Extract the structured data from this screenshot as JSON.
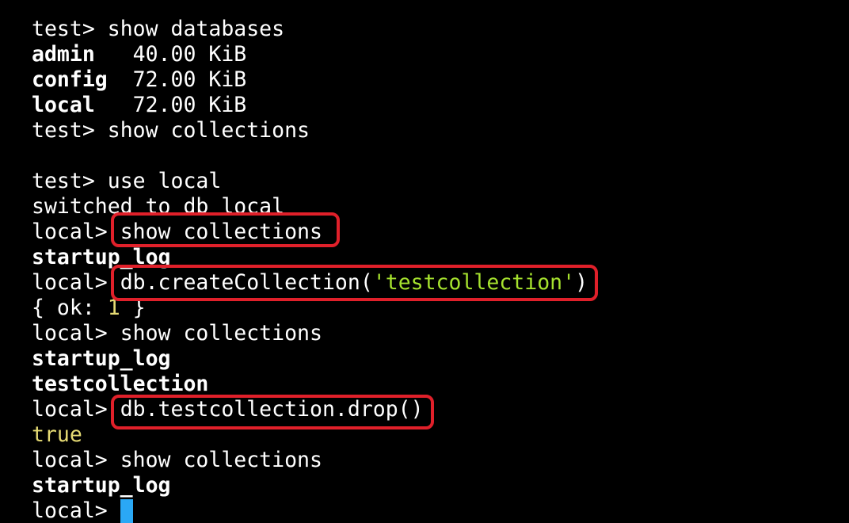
{
  "terminal": {
    "prompt_test": "test> ",
    "prompt_local": "local> ",
    "cmd_show_databases": "show databases",
    "db_list": [
      {
        "name": "admin",
        "size": "   40.00 KiB"
      },
      {
        "name": "config",
        "size": "  72.00 KiB"
      },
      {
        "name": "local",
        "size": "   72.00 KiB"
      }
    ],
    "cmd_show_collections": "show collections",
    "cmd_use_local": "use local",
    "switched_msg": "switched to db local",
    "coll_startup": "startup_log",
    "cmd_create_prefix": "db.createCollection(",
    "cmd_create_arg": "'testcollection'",
    "cmd_create_suffix": ")",
    "ok_prefix": "{ ok: ",
    "ok_value": "1",
    "ok_suffix": " }",
    "coll_test": "testcollection",
    "cmd_drop": "db.testcollection.drop()",
    "true_val": "true"
  },
  "colors": {
    "background": "#000000",
    "text": "#ffffff",
    "string": "#a6e22e",
    "number": "#e6db74",
    "highlight_box": "#e0202a",
    "cursor": "#2aa8f5"
  }
}
